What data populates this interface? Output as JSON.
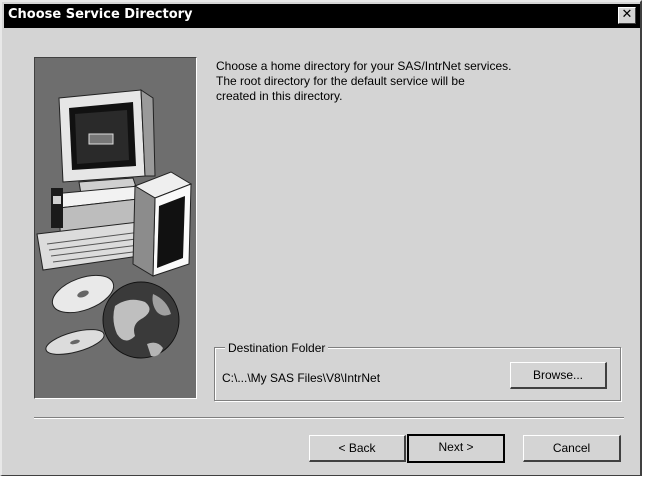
{
  "window": {
    "title": "Choose Service Directory",
    "close_glyph": "✕"
  },
  "description": {
    "lines": [
      "Choose a home directory for your SAS/IntrNet services.",
      "The root directory for the default service will be",
      "created in this directory."
    ]
  },
  "destination": {
    "group_label": "Destination Folder",
    "path": "C:\\...\\My SAS Files\\V8\\IntrNet",
    "browse_label": "Browse..."
  },
  "footer": {
    "back_label": "< Back",
    "next_label": "Next >",
    "cancel_label": "Cancel"
  },
  "icons": {
    "close": "close-icon",
    "illustration": "computer-with-cds-and-globe-illustration"
  }
}
